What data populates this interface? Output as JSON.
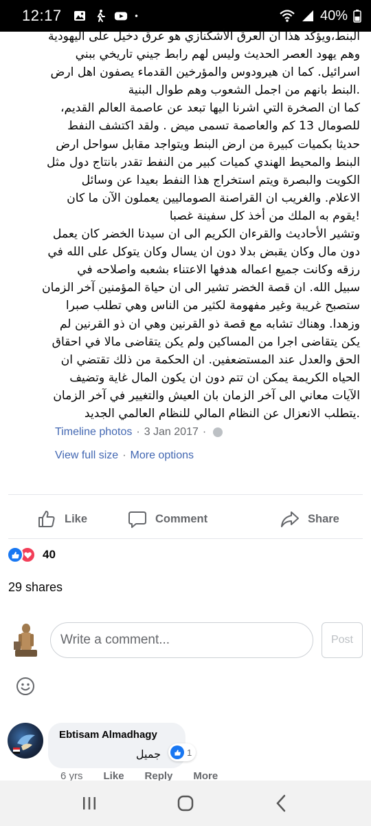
{
  "status_bar": {
    "time": "12:17",
    "battery": "40%"
  },
  "post": {
    "lines": [
      "البنط،ويؤكد هذا ان العرق الأشكنازي هو عرق دخيل على اليهودية",
      "وهم يهود العصر الحديث وليس لهم رابط جيني تاريخي ببني",
      "اسرائيل. كما ان هيرودوس والمؤرخين القدماء يصفون اهل ارض",
      ".البنط بانهم من اجمل الشعوب وهم طوال البنية",
      "كما ان الصخرة التي اشرنا اليها تبعد عن عاصمة العالم القديم،",
      "للصومال 13 كم والعاصمة تسمى ميض . ولقد اكتشف النفط",
      "حديثا بكميات كبيرة من ارض البنط ويتواجد مقابل سواحل ارض",
      "البنط والمحيط الهندي كميات كبير من النفط تقدر بانتاج دول مثل",
      "الكويت والبصرة ويتم استخراج هذا النفط بعيدا عن وسائل",
      "الاعلام. والغريب ان القراصنة الصوماليين يعملون الآن ما كان",
      "!يقوم به الملك من أخذ كل سفينة غصبا",
      "وتشير الأحاديث والقرءان الكريم الى ان سيدنا الخضر كان يعمل",
      "دون مال وكان يقبض بدلا دون ان يسال وكان يتوكل على الله في",
      "رزقه وكانت جميع اعماله هدفها الاعتناء بشعبه واصلاحه في",
      "سبيل الله. ان قصة الخضر تشير الى ان حياة المؤمنين آخر الزمان",
      "ستصبح غريبة وغير مفهومة لكثير من الناس وهي تطلب صبرا",
      "وزهدا. وهناك تشابه مع قصة ذو القرنين وهي ان ذو القرنين لم",
      "يكن يتقاضى اجرا من المساكين ولم يكن يتقاضى مالا في احقاق",
      "الحق والعدل عند المستضعفين. ان الحكمة من ذلك تقتضي ان",
      "الحياه الكريمة يمكن ان تتم دون ان يكون المال غاية وتضيف",
      "الآيات معاني الى آخر الزمان بان العيش والتغيير في آخر الزمان",
      ".يتطلب الانعزال عن النظام المالي للنظام العالمي الجديد"
    ],
    "album": "Timeline photos",
    "separator": "·",
    "date": "3 Jan 2017",
    "view_full_size": "View full size",
    "more_options": "More options"
  },
  "actions": {
    "like": "Like",
    "comment": "Comment",
    "share": "Share"
  },
  "stats": {
    "reactions_count": "40",
    "shares": "29 shares"
  },
  "comment_box": {
    "placeholder": "Write a comment...",
    "post_label": "Post"
  },
  "comments": [
    {
      "author": "Ebtisam Almadhagy",
      "text": "جميل",
      "reaction_count": "1",
      "age": "6 yrs",
      "like_label": "Like",
      "reply_label": "Reply",
      "more_label": "More"
    }
  ],
  "colors": {
    "facebook_blue": "#1877f2",
    "link_blue": "#4267b2",
    "love_red": "#f33e58",
    "secondary_text": "#65676b"
  },
  "icons": [
    "photo-icon",
    "walk-icon",
    "youtube-icon",
    "dot-icon",
    "wifi-icon",
    "signal-icon",
    "battery-icon",
    "globe-icon",
    "like-icon",
    "comment-icon",
    "share-icon",
    "emoji-icon",
    "recents-icon",
    "home-icon",
    "back-icon"
  ]
}
